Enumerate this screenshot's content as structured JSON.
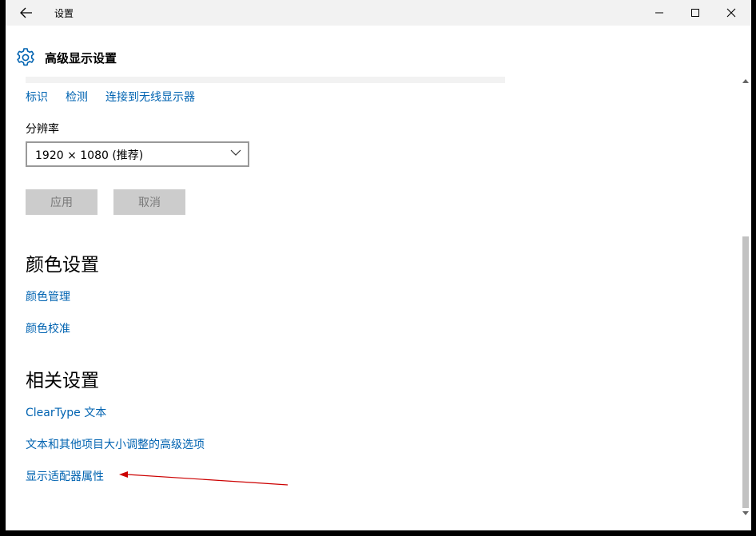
{
  "window": {
    "title": "设置",
    "buttons": {
      "back": "back-arrow-icon",
      "minimize": "minimize-icon",
      "maximize": "maximize-icon",
      "close": "close-icon"
    }
  },
  "header": {
    "title": "高级显示设置",
    "icon": "gear-icon"
  },
  "display_links": [
    "标识",
    "检测",
    "连接到无线显示器"
  ],
  "resolution": {
    "label": "分辨率",
    "value": "1920 × 1080 (推荐)"
  },
  "actions": {
    "apply": "应用",
    "cancel": "取消"
  },
  "color_settings": {
    "title": "颜色设置",
    "links": [
      "颜色管理",
      "颜色校准"
    ]
  },
  "related_settings": {
    "title": "相关设置",
    "links": [
      "ClearType 文本",
      "文本和其他项目大小调整的高级选项",
      "显示适配器属性"
    ]
  },
  "colors": {
    "accent": "#0063b1",
    "annotation_arrow": "#cc0000"
  }
}
